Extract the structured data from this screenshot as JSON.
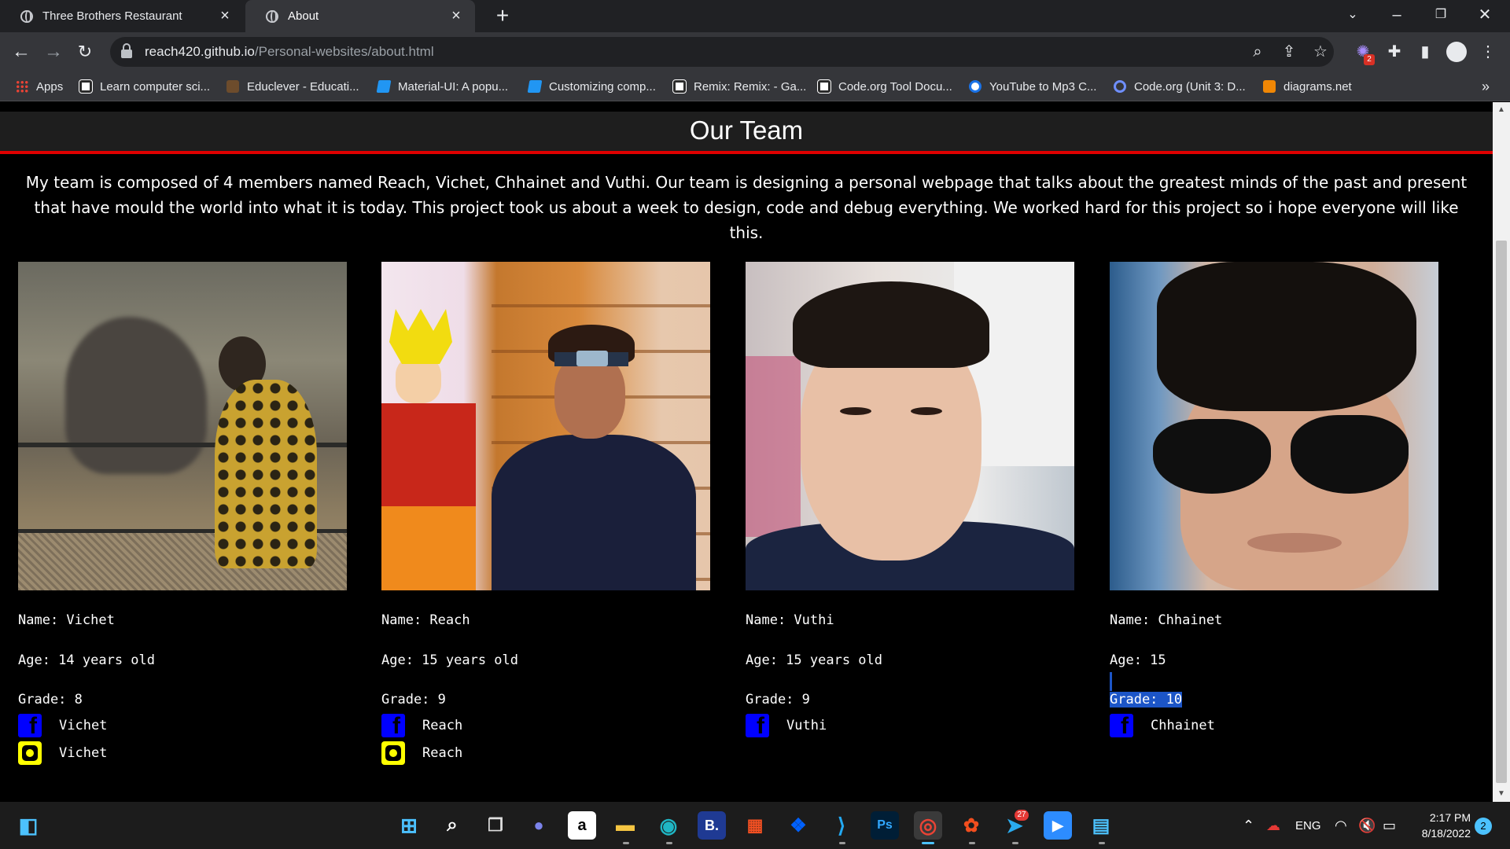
{
  "browser": {
    "tabs": [
      {
        "title": "Three Brothers Restaurant"
      },
      {
        "title": "About"
      }
    ],
    "url": {
      "host": "reach420.github.io",
      "path": "/Personal-websites/about.html"
    },
    "extension_badge": "2",
    "bookmarks": [
      {
        "label": "Apps",
        "icon": "apps-grid-icon"
      },
      {
        "label": "Learn computer sci...",
        "icon": "code-org-icon"
      },
      {
        "label": "Educlever - Educati...",
        "icon": "educlever-icon"
      },
      {
        "label": "Material-UI: A popu...",
        "icon": "material-ui-icon"
      },
      {
        "label": "Customizing comp...",
        "icon": "material-ui-icon"
      },
      {
        "label": "Remix: Remix: - Ga...",
        "icon": "code-org-icon"
      },
      {
        "label": "Code.org Tool Docu...",
        "icon": "code-org-icon"
      },
      {
        "label": "YouTube to Mp3 C...",
        "icon": "download-icon"
      },
      {
        "label": "Code.org (Unit 3: D...",
        "icon": "q-icon"
      },
      {
        "label": "diagrams.net",
        "icon": "diagrams-icon"
      }
    ],
    "more_bookmarks": "»"
  },
  "page": {
    "title": "Our Team",
    "intro": "My team is composed of 4 members named Reach, Vichet, Chhainet and Vuthi. Our team is designing a personal webpage that talks about the greatest minds of the past and present that have mould the world into what it is today. This project took us about a week to design, code and debug everything. We worked hard for this project so i hope everyone will like this.",
    "members": [
      {
        "name": "Name: Vichet",
        "age": "Age: 14 years old",
        "grade": "Grade: 8",
        "facebook": "Vichet",
        "instagram": "Vichet"
      },
      {
        "name": "Name: Reach",
        "age": "Age: 15 years old",
        "grade": "Grade: 9",
        "facebook": "Reach",
        "instagram": "Reach"
      },
      {
        "name": "Name: Vuthi",
        "age": "Age: 15 years old",
        "grade": "Grade: 9",
        "facebook": "Vuthi"
      },
      {
        "name": "Name: Chhainet",
        "age": "Age: 15",
        "grade": "Grade: 10",
        "facebook": "Chhainet"
      }
    ],
    "colors": {
      "header_line": "#e00000",
      "highlight": "#1c55c7",
      "facebook": "#0000ff",
      "instagram": "#ffff00"
    }
  },
  "taskbar": {
    "telegram_badge": "27",
    "tray_language": "ENG",
    "time": "2:17 PM",
    "date": "8/18/2022",
    "notifications": "2"
  }
}
